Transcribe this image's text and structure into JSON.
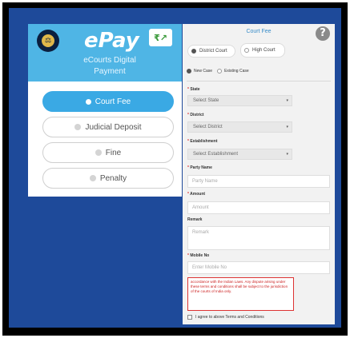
{
  "left": {
    "app_name": "ePay",
    "subtitle": "eCourts Digital Payment",
    "options": [
      {
        "label": "Court Fee",
        "selected": true
      },
      {
        "label": "Judicial Deposit",
        "selected": false
      },
      {
        "label": "Fine",
        "selected": false
      },
      {
        "label": "Penalty",
        "selected": false
      }
    ]
  },
  "right": {
    "title": "Court Fee",
    "court_options": [
      {
        "label": "District Court",
        "selected": true
      },
      {
        "label": "High Court",
        "selected": false
      }
    ],
    "case_options": [
      {
        "label": "New Case",
        "selected": true
      },
      {
        "label": "Existing Case",
        "selected": false
      }
    ],
    "state_label": "State",
    "state_value": "Select State",
    "district_label": "District",
    "district_value": "Select District",
    "establishment_label": "Establishment",
    "establishment_value": "Select Establishment",
    "party_label": "Party Name",
    "party_placeholder": "Party Name",
    "amount_label": "Amount",
    "amount_placeholder": "Amount",
    "remark_label": "Remark",
    "remark_placeholder": "Remark",
    "mobile_label": "Mobile No",
    "mobile_placeholder": "Enter Mobile No",
    "terms_text": "accordance with the Indian Laws. Any dispute arising under these terms and conditions shall be subject to the jurisdiction of the courts of India only.",
    "agree_text": "I agree to above Terms and Conditions"
  },
  "colors": {
    "accent": "#3aa9e4",
    "header": "#4fb5e5",
    "background": "#1e4a9a",
    "error": "#d33333"
  }
}
